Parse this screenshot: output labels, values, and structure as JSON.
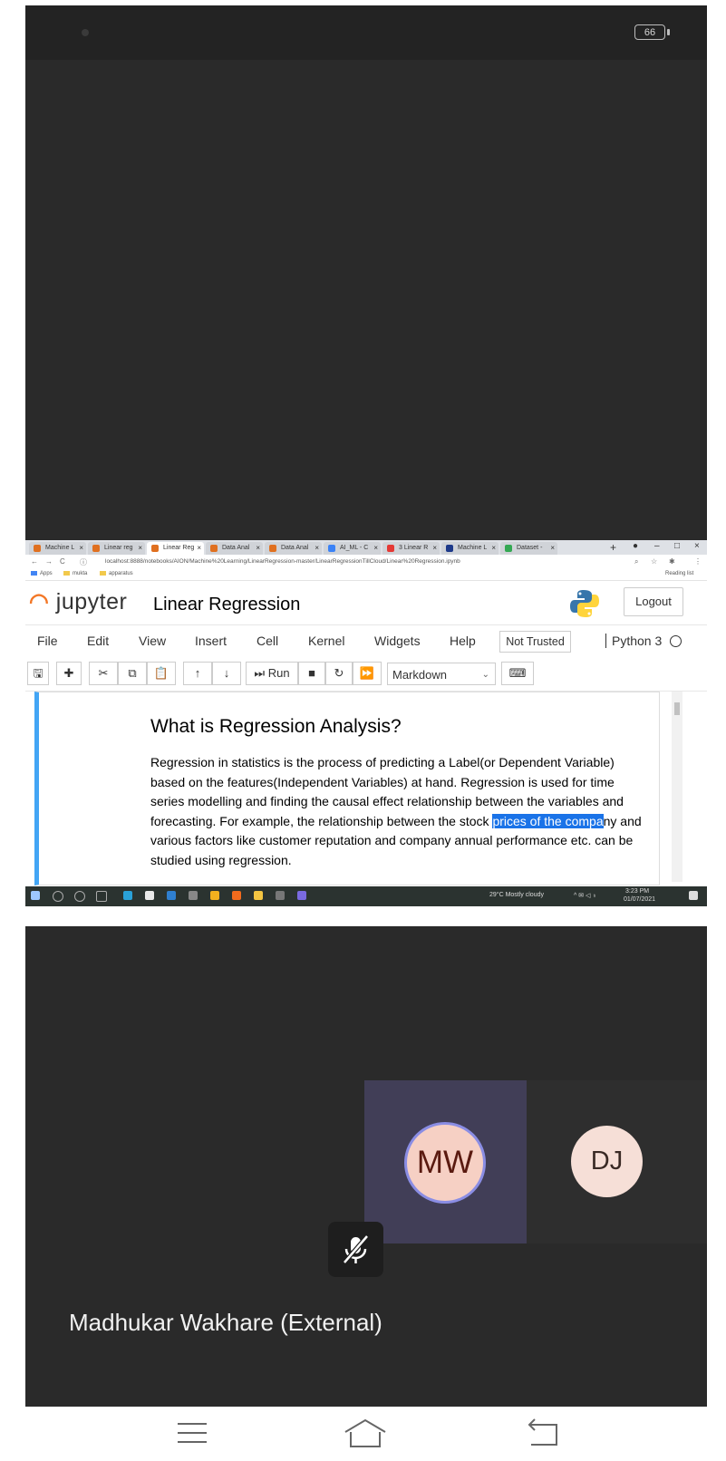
{
  "status_bar": {
    "battery": "66"
  },
  "browser": {
    "tabs": [
      {
        "label": "Machine L",
        "active": false
      },
      {
        "label": "Linear reg",
        "active": false
      },
      {
        "label": "Linear Reg",
        "active": true
      },
      {
        "label": "Data Anal",
        "active": false
      },
      {
        "label": "Data Anal",
        "active": false
      },
      {
        "label": "AI_ML - C",
        "active": false
      },
      {
        "label": "3 Linear R",
        "active": false
      },
      {
        "label": "Machine L",
        "active": false
      },
      {
        "label": "Dataset -",
        "active": false
      }
    ],
    "url": "localhost:8888/notebooks/AION/Machine%20Learning/LinearRegression-master/LinearRegressionTillCloud/Linear%20Regression.ipynb",
    "bookmarks": [
      "Apps",
      "mukta",
      "apparatus"
    ],
    "reading_list": "Reading list"
  },
  "jupyter": {
    "logo_text": "jupyter",
    "notebook_title": "Linear Regression",
    "logout_label": "Logout",
    "menu": [
      "File",
      "Edit",
      "View",
      "Insert",
      "Cell",
      "Kernel",
      "Widgets",
      "Help"
    ],
    "trust_status": "Not Trusted",
    "kernel": "Python 3",
    "toolbar": {
      "run_label": "Run",
      "cell_type": "Markdown"
    },
    "cell": {
      "heading": "What is Regression Analysis?",
      "para_before": "Regression in statistics is the process of predicting a Label(or Dependent Variable) based on the features(Independent Variables) at hand. Regression is used for time series modelling and finding the causal effect relationship between the variables and forecasting. For example, the relationship between the stock ",
      "para_highlight": "prices of the compa",
      "para_after": "ny and various factors like customer reputation and company annual performance etc. can be studied using regression."
    }
  },
  "taskbar": {
    "weather": "29°C  Mostly cloudy",
    "time": "3:23 PM",
    "date": "01/07/2021"
  },
  "meeting": {
    "participants": [
      {
        "initials": "MW",
        "active": true
      },
      {
        "initials": "DJ",
        "active": false
      }
    ],
    "presenter_name": "Madhukar Wakhare (External)"
  },
  "colors": {
    "jupyter_orange": "#f37726",
    "cell_selected": "#42a5f5",
    "text_highlight": "#1a73e8",
    "active_speaker_tile": "#413e57"
  }
}
